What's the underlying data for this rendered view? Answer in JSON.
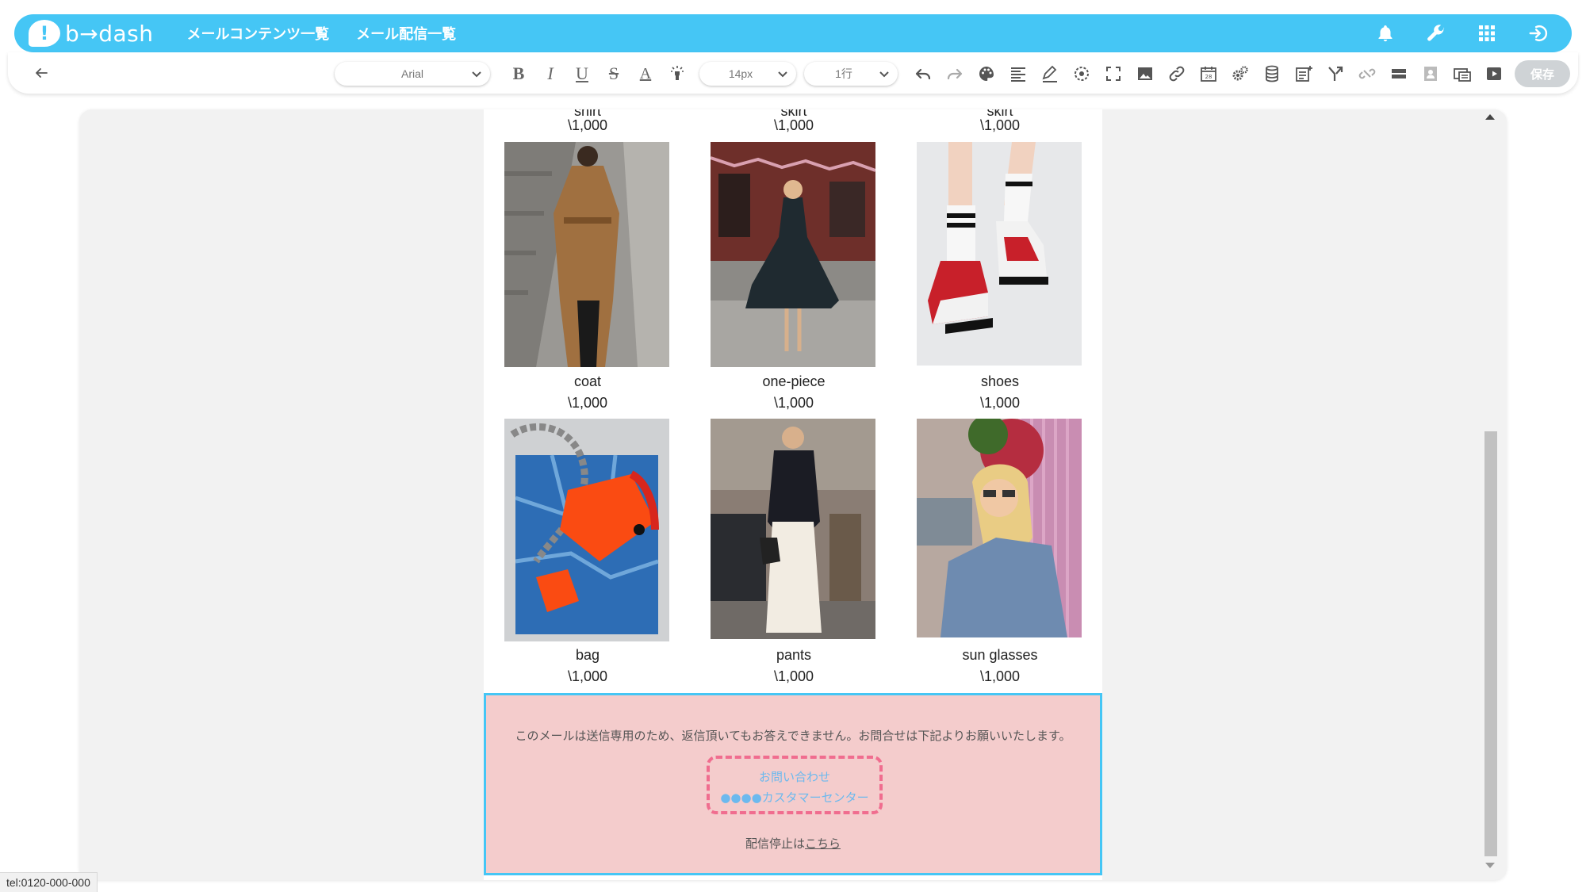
{
  "app": {
    "logo_text": "b→dash",
    "nav": [
      "メールコンテンツ一覧",
      "メール配信一覧"
    ]
  },
  "top_icons": [
    "bell-icon",
    "wrench-icon",
    "grid-icon",
    "logout-icon"
  ],
  "toolbar": {
    "font_family": "Arial",
    "font_size": "14px",
    "line_height": "1行",
    "bold": "B",
    "italic": "I",
    "underline": "U",
    "strike": "S",
    "text_color": "A",
    "save_label": "保存"
  },
  "products_partial": [
    {
      "label": "shirt",
      "price": "\\1,000"
    },
    {
      "label": "skirt",
      "price": "\\1,000"
    },
    {
      "label": "skirt",
      "price": "\\1,000"
    }
  ],
  "products": [
    {
      "name": "coat",
      "price": "\\1,000"
    },
    {
      "name": "one-piece",
      "price": "\\1,000"
    },
    {
      "name": "shoes",
      "price": "\\1,000"
    },
    {
      "name": "bag",
      "price": "\\1,000"
    },
    {
      "name": "pants",
      "price": "\\1,000"
    },
    {
      "name": "sun glasses",
      "price": "\\1,000"
    }
  ],
  "footer": {
    "note": "このメールは送信専用のため、返信頂いてもお答えできません。お問合せは下記よりお願いいたします。",
    "contact_title": "お問い合わせ",
    "contact_center": "●●●●カスタマーセンター",
    "unsubscribe_prefix": "配信停止は",
    "unsubscribe_link": "こちら"
  },
  "status_tooltip": "tel:0120-000-000",
  "colors": {
    "brand": "#45c6f5",
    "footer_bg": "#f4cccc",
    "contact_border": "#f06d8f",
    "link": "#6cb9ee"
  }
}
